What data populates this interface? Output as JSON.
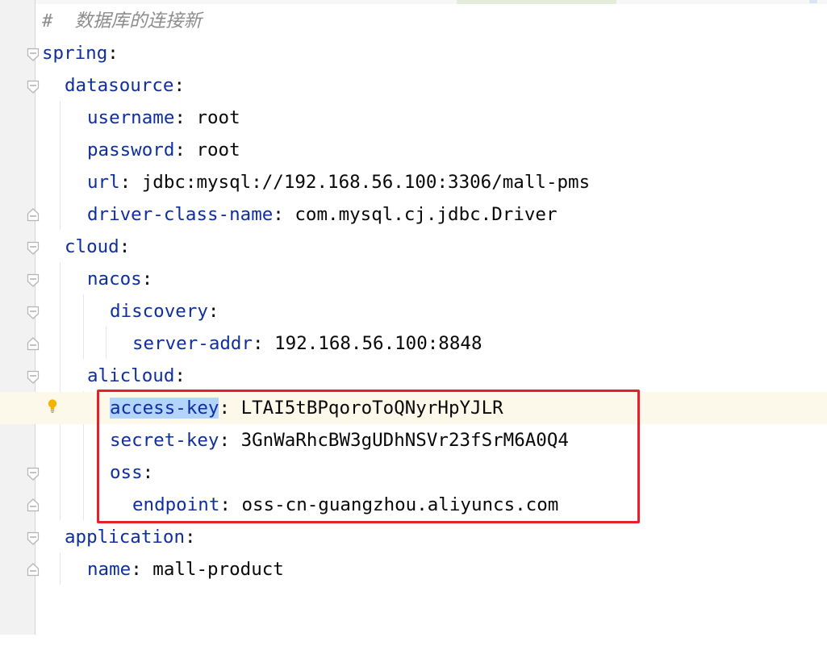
{
  "editor": {
    "file_type": "yaml",
    "highlighted_section": "alicloud credentials",
    "lines": [
      {
        "comment": "#  数据库的连接新"
      },
      {
        "key": "spring",
        "sep": ":"
      },
      {
        "key": "datasource",
        "sep": ":"
      },
      {
        "key": "username",
        "sep": ": ",
        "value": "root"
      },
      {
        "key": "password",
        "sep": ": ",
        "value": "root"
      },
      {
        "key": "url",
        "sep": ": ",
        "value": "jdbc:mysql://192.168.56.100:3306/mall-pms"
      },
      {
        "key": "driver-class-name",
        "sep": ": ",
        "value": "com.mysql.cj.jdbc.Driver"
      },
      {
        "key": "cloud",
        "sep": ":"
      },
      {
        "key": "nacos",
        "sep": ":"
      },
      {
        "key": "discovery",
        "sep": ":"
      },
      {
        "key": "server-addr",
        "sep": ": ",
        "value": "192.168.56.100:8848"
      },
      {
        "key": "alicloud",
        "sep": ":"
      },
      {
        "key": "access-key",
        "sep": ": ",
        "value": "LTAI5tBPqoroToQNyrHpYJLR"
      },
      {
        "key": "secret-key",
        "sep": ": ",
        "value": "3GnWaRhcBW3gUDhNSVr23fSrM6A0Q4"
      },
      {
        "key": "oss",
        "sep": ":"
      },
      {
        "key": "endpoint",
        "sep": ": ",
        "value": "oss-cn-guangzhou.aliyuncs.com"
      },
      {
        "key": "application",
        "sep": ":"
      },
      {
        "key": "name",
        "sep": ": ",
        "value": "mall-product"
      }
    ]
  },
  "colors": {
    "key": "#0e2f9e",
    "value": "#080808",
    "comment": "#8c8c8c",
    "selection": "#b3d4fc",
    "current_line": "#fcf9ea",
    "annotation_box": "#e5202b",
    "intention_bulb": "#f2b400"
  },
  "icons": [
    "fold-open-icon",
    "fold-close-icon",
    "intention-bulb-icon"
  ]
}
